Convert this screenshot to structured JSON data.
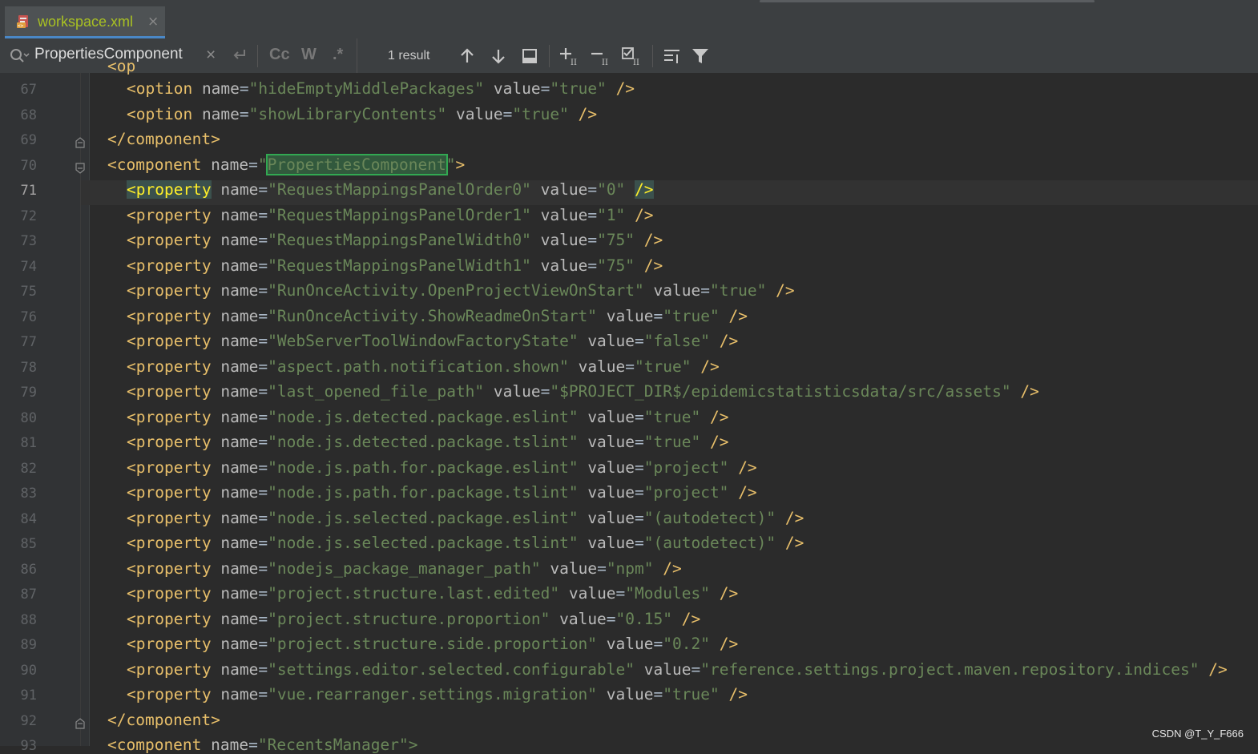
{
  "tab": {
    "title": "workspace.xml",
    "close": "×"
  },
  "find": {
    "query": "PropertiesComponent",
    "result_count": "1 result",
    "case_label": "Cc",
    "words_label": "W",
    "regex_label": ".*"
  },
  "editor": {
    "current_line": 71,
    "lines": [
      {
        "n": "67",
        "indent": 1,
        "tag": "option",
        "attrs": [
          [
            "name",
            "hideEmptyMiddlePackages"
          ],
          [
            "value",
            "true"
          ]
        ]
      },
      {
        "n": "68",
        "indent": 1,
        "tag": "option",
        "attrs": [
          [
            "name",
            "showLibraryContents"
          ],
          [
            "value",
            "true"
          ]
        ]
      },
      {
        "n": "69",
        "indent": 0,
        "close": "component"
      },
      {
        "n": "70",
        "indent": 0,
        "tag": "component",
        "attrs": [
          [
            "name",
            "PropertiesComponent"
          ]
        ],
        "open": true,
        "match": true
      },
      {
        "n": "71",
        "indent": 1,
        "tag": "property",
        "attrs": [
          [
            "name",
            "RequestMappingsPanelOrder0"
          ],
          [
            "value",
            "0"
          ]
        ],
        "current": true
      },
      {
        "n": "72",
        "indent": 1,
        "tag": "property",
        "attrs": [
          [
            "name",
            "RequestMappingsPanelOrder1"
          ],
          [
            "value",
            "1"
          ]
        ]
      },
      {
        "n": "73",
        "indent": 1,
        "tag": "property",
        "attrs": [
          [
            "name",
            "RequestMappingsPanelWidth0"
          ],
          [
            "value",
            "75"
          ]
        ]
      },
      {
        "n": "74",
        "indent": 1,
        "tag": "property",
        "attrs": [
          [
            "name",
            "RequestMappingsPanelWidth1"
          ],
          [
            "value",
            "75"
          ]
        ]
      },
      {
        "n": "75",
        "indent": 1,
        "tag": "property",
        "attrs": [
          [
            "name",
            "RunOnceActivity.OpenProjectViewOnStart"
          ],
          [
            "value",
            "true"
          ]
        ]
      },
      {
        "n": "76",
        "indent": 1,
        "tag": "property",
        "attrs": [
          [
            "name",
            "RunOnceActivity.ShowReadmeOnStart"
          ],
          [
            "value",
            "true"
          ]
        ]
      },
      {
        "n": "77",
        "indent": 1,
        "tag": "property",
        "attrs": [
          [
            "name",
            "WebServerToolWindowFactoryState"
          ],
          [
            "value",
            "false"
          ]
        ]
      },
      {
        "n": "78",
        "indent": 1,
        "tag": "property",
        "attrs": [
          [
            "name",
            "aspect.path.notification.shown"
          ],
          [
            "value",
            "true"
          ]
        ]
      },
      {
        "n": "79",
        "indent": 1,
        "tag": "property",
        "attrs": [
          [
            "name",
            "last_opened_file_path"
          ],
          [
            "value",
            "$PROJECT_DIR$/epidemicstatisticsdata/src/assets"
          ]
        ]
      },
      {
        "n": "80",
        "indent": 1,
        "tag": "property",
        "attrs": [
          [
            "name",
            "node.js.detected.package.eslint"
          ],
          [
            "value",
            "true"
          ]
        ]
      },
      {
        "n": "81",
        "indent": 1,
        "tag": "property",
        "attrs": [
          [
            "name",
            "node.js.detected.package.tslint"
          ],
          [
            "value",
            "true"
          ]
        ]
      },
      {
        "n": "82",
        "indent": 1,
        "tag": "property",
        "attrs": [
          [
            "name",
            "node.js.path.for.package.eslint"
          ],
          [
            "value",
            "project"
          ]
        ]
      },
      {
        "n": "83",
        "indent": 1,
        "tag": "property",
        "attrs": [
          [
            "name",
            "node.js.path.for.package.tslint"
          ],
          [
            "value",
            "project"
          ]
        ]
      },
      {
        "n": "84",
        "indent": 1,
        "tag": "property",
        "attrs": [
          [
            "name",
            "node.js.selected.package.eslint"
          ],
          [
            "value",
            "(autodetect)"
          ]
        ]
      },
      {
        "n": "85",
        "indent": 1,
        "tag": "property",
        "attrs": [
          [
            "name",
            "node.js.selected.package.tslint"
          ],
          [
            "value",
            "(autodetect)"
          ]
        ]
      },
      {
        "n": "86",
        "indent": 1,
        "tag": "property",
        "attrs": [
          [
            "name",
            "nodejs_package_manager_path"
          ],
          [
            "value",
            "npm"
          ]
        ]
      },
      {
        "n": "87",
        "indent": 1,
        "tag": "property",
        "attrs": [
          [
            "name",
            "project.structure.last.edited"
          ],
          [
            "value",
            "Modules"
          ]
        ]
      },
      {
        "n": "88",
        "indent": 1,
        "tag": "property",
        "attrs": [
          [
            "name",
            "project.structure.proportion"
          ],
          [
            "value",
            "0.15"
          ]
        ]
      },
      {
        "n": "89",
        "indent": 1,
        "tag": "property",
        "attrs": [
          [
            "name",
            "project.structure.side.proportion"
          ],
          [
            "value",
            "0.2"
          ]
        ]
      },
      {
        "n": "90",
        "indent": 1,
        "tag": "property",
        "attrs": [
          [
            "name",
            "settings.editor.selected.configurable"
          ],
          [
            "value",
            "reference.settings.project.maven.repository.indices"
          ]
        ]
      },
      {
        "n": "91",
        "indent": 1,
        "tag": "property",
        "attrs": [
          [
            "name",
            "vue.rearranger.settings.migration"
          ],
          [
            "value",
            "true"
          ]
        ]
      },
      {
        "n": "92",
        "indent": 0,
        "close": "component"
      },
      {
        "n": "93",
        "indent": 0,
        "tag": "component",
        "attrs": [
          [
            "name",
            "RecentsManager"
          ]
        ],
        "open": true,
        "partial": true
      }
    ]
  },
  "watermark": "CSDN @T_Y_F666",
  "colors": {
    "tag": "#e8bf6a",
    "attr": "#bababa",
    "value": "#6a8759",
    "background": "#2b2b2b",
    "gutter": "#313335"
  }
}
